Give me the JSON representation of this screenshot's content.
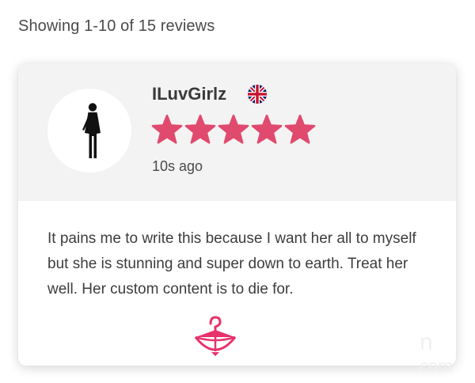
{
  "reviews_summary": "Showing 1-10 of 15 reviews",
  "review": {
    "username": "ILuvGirlz",
    "country_flag_icon": "uk-flag-icon",
    "avatar_icon": "female-silhouette-icon",
    "rating": 5,
    "rating_max": 5,
    "time_ago": "10s ago",
    "text": "It pains me to write this because I want her all to myself but she is stunning and super down to earth. Treat her well. Her custom content is to die for."
  },
  "decoration_icon": "hanger-bow-icon",
  "colors": {
    "star": "#e04a6e",
    "accent_pink": "#e8326a",
    "header_bg": "#f3f3f3"
  }
}
